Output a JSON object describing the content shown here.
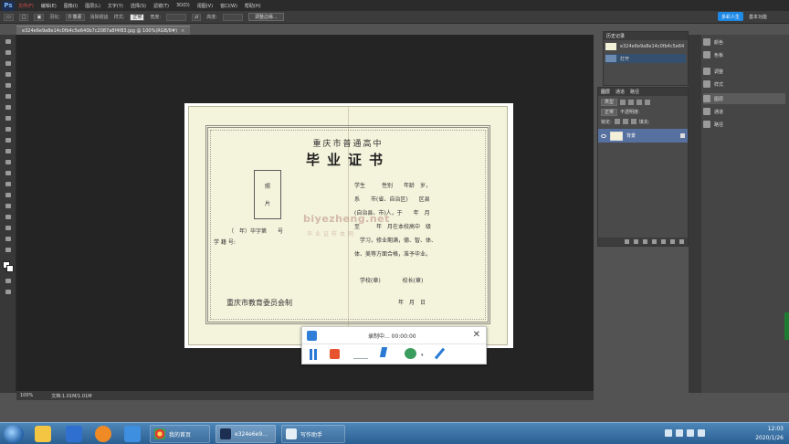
{
  "menubar": {
    "logo": "Ps",
    "items": [
      "文件(F)",
      "编辑(E)",
      "图像(I)",
      "图层(L)",
      "文字(Y)",
      "选择(S)",
      "滤镜(T)",
      "3D(D)",
      "视图(V)",
      "窗口(W)",
      "帮助(H)"
    ]
  },
  "options": {
    "feather_label": "羽化:",
    "feather_value": "0 像素",
    "antialias": "消除锯齿",
    "style_label": "样式:",
    "style_value": "正常",
    "width_label": "宽度:",
    "height_label": "高度:",
    "refine_edge": "调整边缘...",
    "wx_tag": "多彩人生",
    "workspace": "基本功能"
  },
  "doc_tab": {
    "title": "e324e6e9a8e14c0fb4c5e640b7c2087a8f4f83.jpg @ 100%(RGB/8#)",
    "close": "×"
  },
  "certificate": {
    "subtitle": "重庆市普通高中",
    "title": "毕业证书",
    "photo_line1": "照",
    "photo_line2": "片",
    "grade_line": "（　年）毕字第　　号",
    "student_no": "学 籍 号:",
    "issuer": "重庆市教育委员会制",
    "right_lines": [
      "学生　　　性别　　年龄　岁，",
      "系　　市(省、自治区)　　区县",
      "(自治县、市)人，于　　年　月",
      "至　　　年　月在本校高中　级",
      "　学习，修业期满，德、智、体、",
      "体、美等方面合格，准予毕业。",
      "　学校(章)　　　　校长(章)",
      "　　　　　　　　年　月　日"
    ],
    "watermark": "biyezheng.net",
    "watermark_sub": "毕业证样本网"
  },
  "recorder": {
    "status": "录制中... 00:00:00",
    "close": "✕"
  },
  "history_panel": {
    "tabs": "历史记录",
    "row1": "e324e6e9a8e14c0fb4c5e640b7c2087a8f4f83",
    "row2": "打开"
  },
  "side_panel": {
    "items": [
      "颜色",
      "色板",
      "调整",
      "样式",
      "图层",
      "通道",
      "路径"
    ]
  },
  "layers_panel": {
    "tabs": [
      "图层",
      "通道",
      "路径"
    ],
    "kind": "类型",
    "blend_mode": "正常",
    "opacity_label": "不透明度:",
    "lock_label": "锁定:",
    "fill_label": "填充:",
    "layer_name": "背景"
  },
  "statusbar": {
    "zoom": "100%",
    "doc": "文档:1.01M/1.01M"
  },
  "taskbar": {
    "apps": [
      "我的首页",
      "e324e6e9...",
      "写作助手"
    ],
    "time": "12:03",
    "date": "2020/1/26"
  },
  "colors": {
    "recorder_blue": "#2a7ad5",
    "recorder_red": "#e8532f",
    "layer_selected": "#5670a0"
  }
}
